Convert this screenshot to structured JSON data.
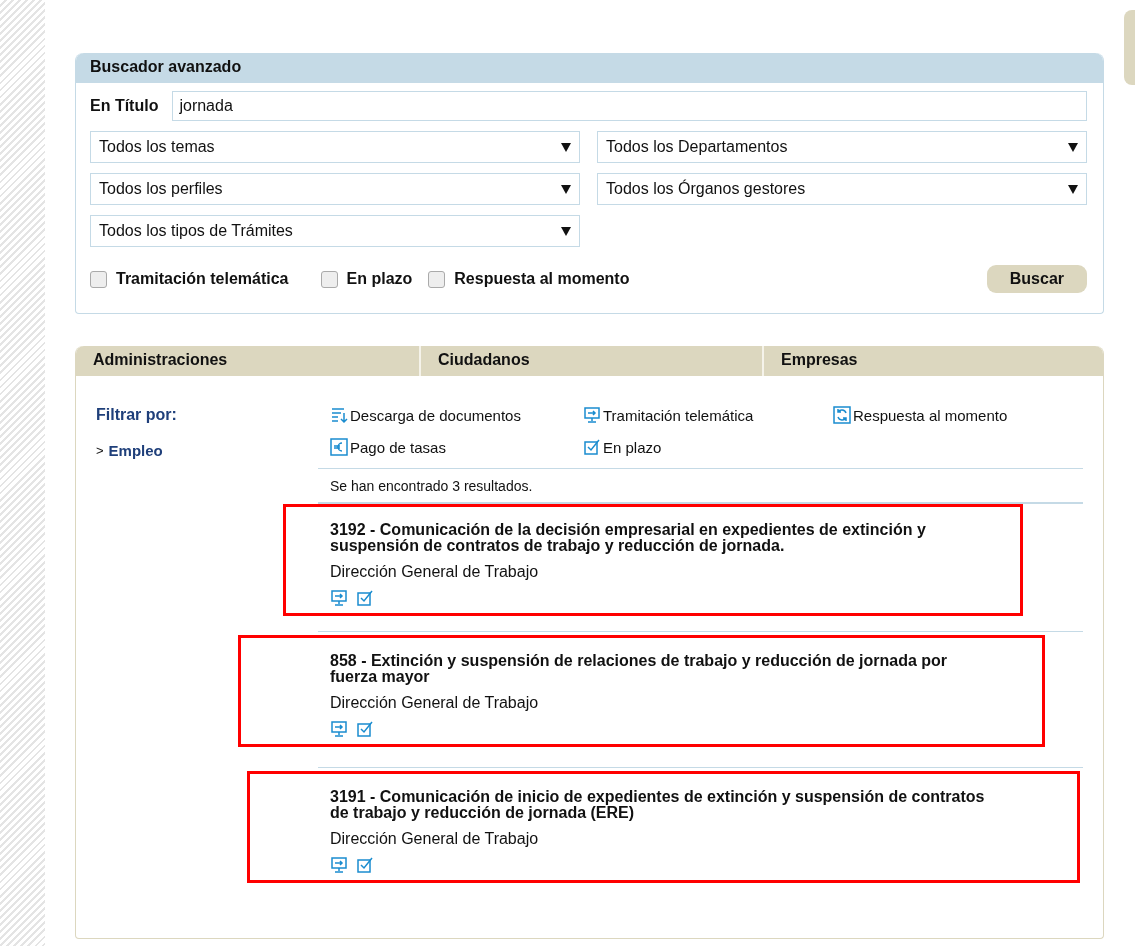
{
  "search": {
    "title": "Buscador avanzado",
    "title_label": "En Título",
    "title_value": "jornada",
    "selects": [
      {
        "value": "Todos los temas"
      },
      {
        "value": "Todos los Departamentos"
      },
      {
        "value": "Todos los perfiles"
      },
      {
        "value": "Todos los Órganos gestores"
      },
      {
        "value": "Todos los tipos de Trámites"
      }
    ],
    "checkboxes": [
      {
        "label": "Tramitación telemática",
        "checked": false
      },
      {
        "label": "En plazo",
        "checked": false
      },
      {
        "label": "Respuesta al momento",
        "checked": false
      }
    ],
    "button": "Buscar"
  },
  "tabs": [
    {
      "label": "Administraciones"
    },
    {
      "label": "Ciudadanos"
    },
    {
      "label": "Empresas"
    }
  ],
  "filter": {
    "title": "Filtrar por:",
    "items": [
      {
        "marker": ">",
        "label": "Empleo"
      }
    ]
  },
  "legend": [
    {
      "kind": "download",
      "label": "Descarga de documentos"
    },
    {
      "kind": "telematic",
      "label": "Tramitación telemática"
    },
    {
      "kind": "instant",
      "label": "Respuesta al momento"
    },
    {
      "kind": "fee",
      "label": "Pago de tasas"
    },
    {
      "kind": "deadline",
      "label": "En plazo"
    }
  ],
  "result_count": "Se han encontrado 3 resultados.",
  "results": [
    {
      "title": "3192 - Comunicación de la decisión empresarial en expedientes de extinción y suspensión de contratos de trabajo y reducción de jornada.",
      "body": "Dirección General de Trabajo",
      "features": [
        {
          "kind": "telematic"
        },
        {
          "kind": "deadline"
        }
      ]
    },
    {
      "title": "858 - Extinción y suspensión de relaciones de trabajo y reducción de jornada por fuerza mayor",
      "body": "Dirección General de Trabajo",
      "features": [
        {
          "kind": "telematic"
        },
        {
          "kind": "deadline"
        }
      ]
    },
    {
      "title": "3191 - Comunicación de inicio de expedientes de extinción y suspensión de contratos de trabajo y reducción de jornada (ERE)",
      "body": "Dirección General de Trabajo",
      "features": [
        {
          "kind": "telematic"
        },
        {
          "kind": "deadline"
        }
      ]
    }
  ]
}
